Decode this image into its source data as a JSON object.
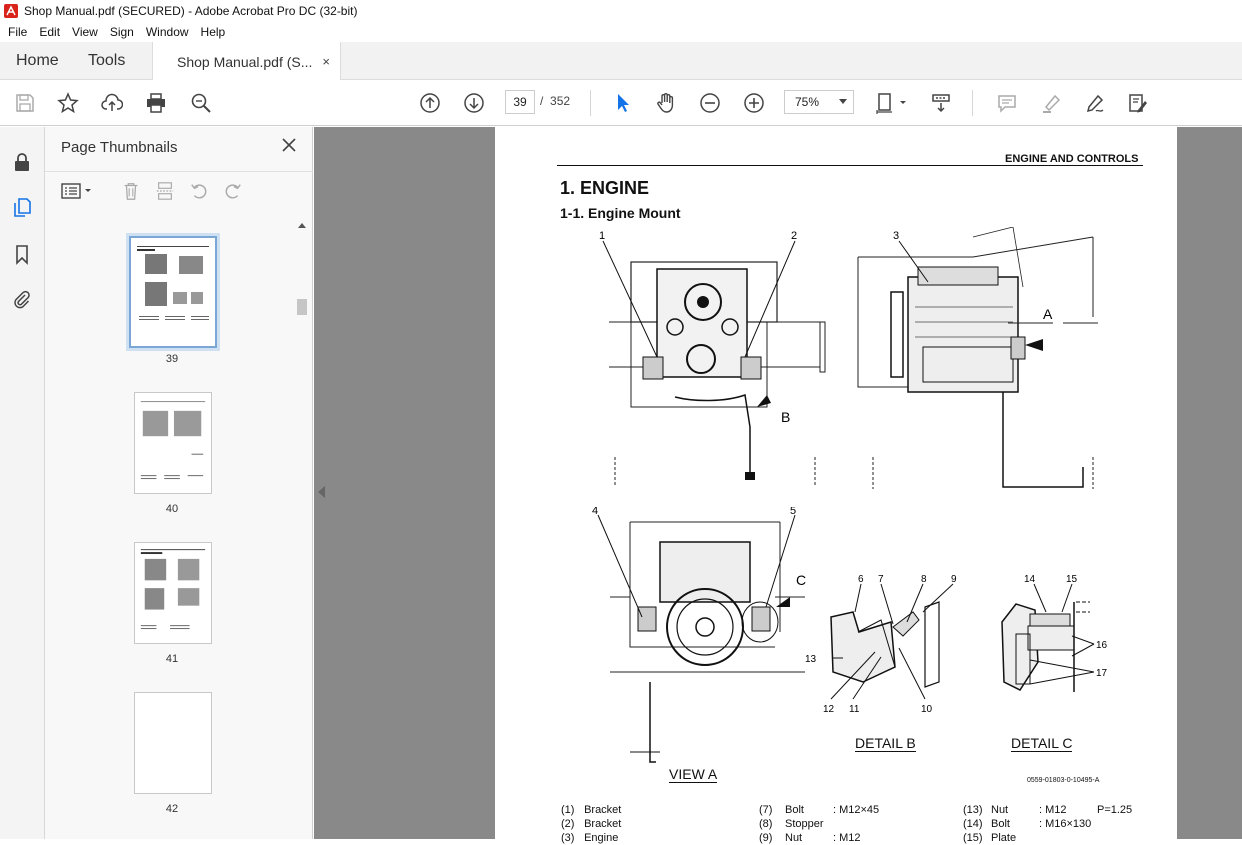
{
  "window": {
    "title": "Shop Manual.pdf (SECURED) - Adobe Acrobat Pro DC (32-bit)"
  },
  "menu": [
    "File",
    "Edit",
    "View",
    "Sign",
    "Window",
    "Help"
  ],
  "tabs": {
    "home": "Home",
    "tools": "Tools",
    "document": "Shop Manual.pdf (S...",
    "close": "×"
  },
  "toolbar": {
    "page_current": "39",
    "page_sep": "/",
    "page_total": "352",
    "zoom": "75%"
  },
  "panel": {
    "title": "Page Thumbnails",
    "thumbnails": [
      {
        "label": "39",
        "selected": true
      },
      {
        "label": "40",
        "selected": false
      },
      {
        "label": "41",
        "selected": false
      },
      {
        "label": "42",
        "selected": false
      }
    ]
  },
  "document": {
    "header": "ENGINE AND CONTROLS",
    "heading1": "1. ENGINE",
    "heading2": "1-1. Engine Mount",
    "callouts_top_left": [
      "1",
      "2",
      "B"
    ],
    "callouts_top_right": [
      "3",
      "A"
    ],
    "callouts_bottom_left": [
      "4",
      "5",
      "C"
    ],
    "callouts_detail_b": [
      "6",
      "7",
      "8",
      "9",
      "13",
      "12",
      "11",
      "10"
    ],
    "callouts_detail_c": [
      "14",
      "15",
      "16",
      "17"
    ],
    "view_a": "VIEW  A",
    "detail_b": "DETAIL  B",
    "detail_c": "DETAIL  C",
    "figure_code": "0559-01803-0-10495-A",
    "legend": [
      {
        "num": "(1)",
        "name": "Bracket"
      },
      {
        "num": "(2)",
        "name": "Bracket"
      },
      {
        "num": "(3)",
        "name": "Engine"
      },
      {
        "num": "(7)",
        "name": "Bolt",
        "spec": ": M12×45"
      },
      {
        "num": "(8)",
        "name": "Stopper",
        "spec": ""
      },
      {
        "num": "(9)",
        "name": "Nut",
        "spec": ": M12"
      },
      {
        "num": "(13)",
        "name": "Nut",
        "spec": ": M12",
        "extra": "P=1.25"
      },
      {
        "num": "(14)",
        "name": "Bolt",
        "spec": ": M16×130",
        "extra": ""
      },
      {
        "num": "(15)",
        "name": "Plate",
        "spec": "",
        "extra": ""
      }
    ]
  },
  "colors": {
    "accent": "#1473e6",
    "viewer_bg": "#898989",
    "app_icon": "#d9241c"
  }
}
